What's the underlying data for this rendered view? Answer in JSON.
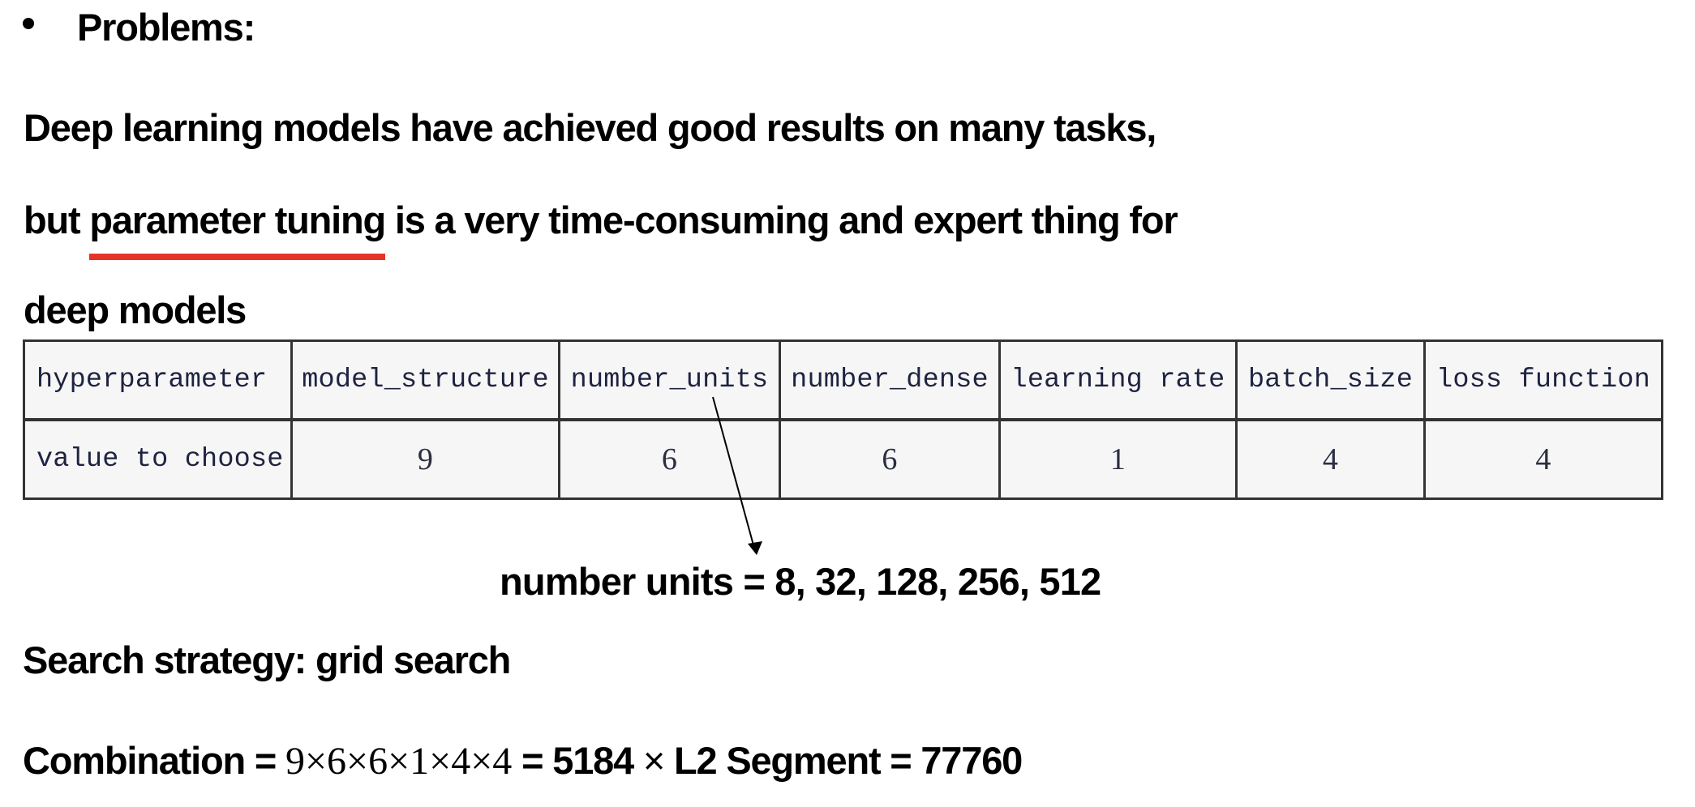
{
  "heading": {
    "bullet": "•",
    "title": "Problems:"
  },
  "paragraph": {
    "line1": "Deep learning models have achieved good results on many tasks,",
    "line2_prefix": "but ",
    "line2_highlight": "parameter tuning",
    "line2_suffix": " is a very time-consuming and expert thing for",
    "line3": "deep models",
    "highlight_color": "#e53528"
  },
  "table": {
    "rows": [
      {
        "label": "hyperparameter",
        "cells": [
          "model_structure",
          "number_units",
          "number_dense",
          "learning rate",
          "batch_size",
          "loss function"
        ]
      },
      {
        "label": "value to choose",
        "cells": [
          "9",
          "6",
          "6",
          "1",
          "4",
          "4"
        ]
      }
    ]
  },
  "annotation": {
    "points_to": "number_units",
    "text": "number units = 8, 32, 128, 256, 512"
  },
  "strategy": {
    "text": "Search strategy: grid search"
  },
  "combination": {
    "label": "Combination = ",
    "expression": "9×6×6×1×4×4",
    "result": " = 5184 ",
    "times": "×",
    "segment": " L2 Segment = 77760"
  }
}
